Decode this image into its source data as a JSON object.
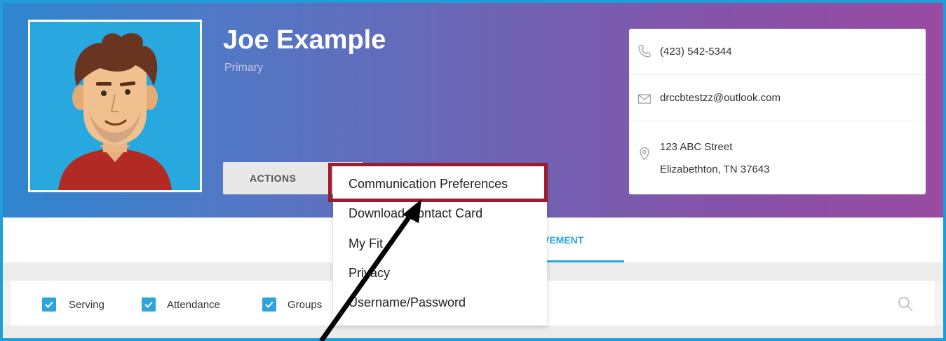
{
  "profile": {
    "name": "Joe Example",
    "subtitle": "Primary",
    "avatar_icon": "person-avatar-icon"
  },
  "actions": {
    "label": "ACTIONS",
    "menu_items": [
      "Communication Preferences",
      "Download Contact Card",
      "My Fit",
      "Privacy",
      "Username/Password"
    ],
    "highlighted_item": "Communication Preferences"
  },
  "contact": {
    "phone": "(423) 542-5344",
    "email": "drccbtestzz@outlook.com",
    "address_line1": "123 ABC Street",
    "address_line2": "Elizabethton, TN 37643",
    "icons": [
      "phone-icon",
      "mail-icon",
      "location-pin-icon"
    ]
  },
  "tabs": {
    "active_partial_label": "VEMENT"
  },
  "filters": [
    {
      "label": "Serving",
      "checked": true
    },
    {
      "label": "Attendance",
      "checked": true
    },
    {
      "label": "Groups",
      "checked": true
    }
  ],
  "colors": {
    "accent": "#29a7df",
    "highlight_border": "#9b1c2c",
    "frame_border": "#1e9fd8",
    "banner_start": "#2f86cf",
    "banner_end": "#9a4aa2"
  }
}
